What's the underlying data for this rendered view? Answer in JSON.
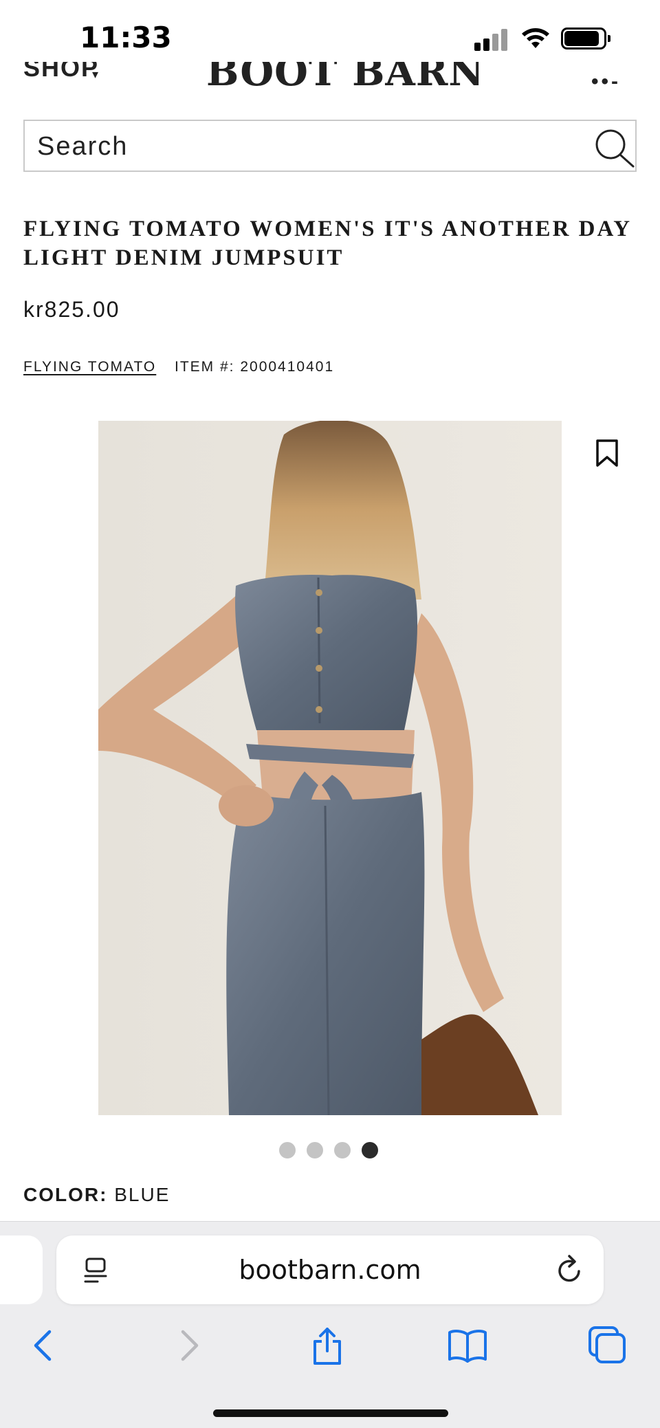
{
  "status_bar": {
    "time": "11:33"
  },
  "header": {
    "shop_label": "SHOP",
    "logo_text": "BOOT BARN"
  },
  "search": {
    "placeholder": "Search"
  },
  "product": {
    "title": "FLYING TOMATO WOMEN'S IT'S ANOTHER DAY LIGHT DENIM JUMPSUIT",
    "price": "kr825.00",
    "brand": "FLYING TOMATO",
    "item_number": "ITEM #: 2000410401",
    "color_label": "COLOR:",
    "color_value": "BLUE"
  },
  "carousel": {
    "count": 4,
    "active_index": 3
  },
  "browser": {
    "url": "bootbarn.com"
  },
  "colors": {
    "accent_blue": "#1a73e8",
    "dot_active": "#2b2b2b",
    "dot_inactive": "#c4c4c4",
    "denim": "#6a7685"
  }
}
